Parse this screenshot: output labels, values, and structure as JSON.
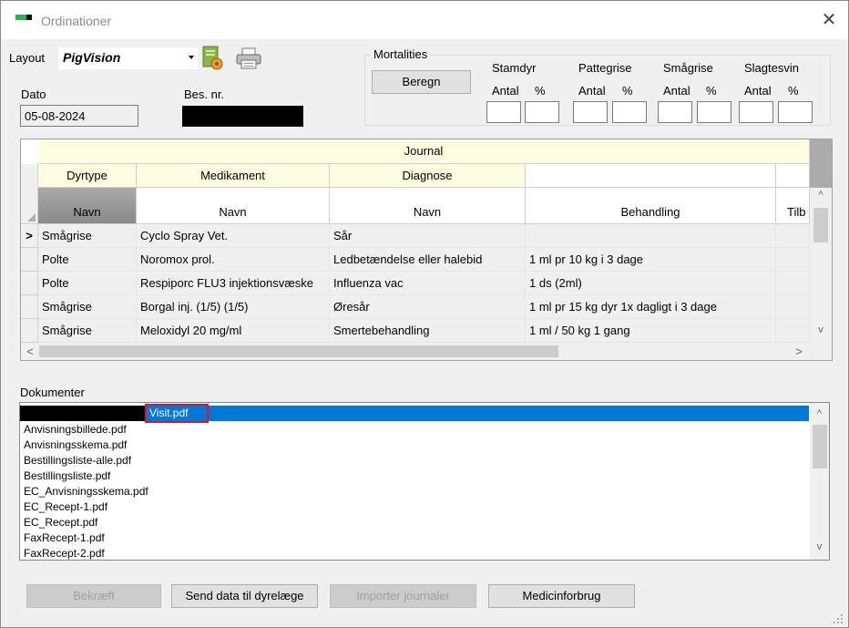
{
  "window": {
    "title": "Ordinationer",
    "close_glyph": "✕"
  },
  "layout": {
    "label": "Layout",
    "value": "PigVision"
  },
  "dato": {
    "label": "Dato",
    "value": "05-08-2024"
  },
  "besnr": {
    "label": "Bes. nr.",
    "value": ""
  },
  "mortalities": {
    "legend": "Mortalities",
    "button": "Beregn",
    "groups": [
      {
        "name": "Stamdyr",
        "antal": "Antal",
        "pct": "%"
      },
      {
        "name": "Pattegrise",
        "antal": "Antal",
        "pct": "%"
      },
      {
        "name": "Smågrise",
        "antal": "Antal",
        "pct": "%"
      },
      {
        "name": "Slagtesvin",
        "antal": "Antal",
        "pct": "%"
      }
    ]
  },
  "grid": {
    "band_title": "Journal",
    "group_headers": [
      "Dyrtype",
      "Medikament",
      "Diagnose"
    ],
    "columns": [
      "Navn",
      "Navn",
      "Navn",
      "Behandling",
      "Tilb"
    ],
    "current_row_marker": ">",
    "rows": [
      [
        "Smågrise",
        "Cyclo Spray Vet.",
        "Sår",
        ""
      ],
      [
        "Polte",
        "Noromox prol.",
        "Ledbetændelse eller halebid",
        "1 ml pr 10 kg i 3 dage"
      ],
      [
        "Polte",
        "Respiporc FLU3 injektionsvæske",
        "Influenza vac",
        "1 ds (2ml)"
      ],
      [
        "Smågrise",
        "Borgal inj. (1/5) (1/5)",
        "Øresår",
        "1 ml pr 15 kg dyr 1x dagligt i 3 dage"
      ],
      [
        "Smågrise",
        "Meloxidyl 20 mg/ml",
        "Smertebehandling",
        "1 ml / 50 kg 1 gang"
      ]
    ],
    "scroll_up": "^",
    "scroll_down": "v",
    "scroll_left": "<",
    "scroll_right": ">"
  },
  "documents": {
    "label": "Dokumenter",
    "selected": "Visit.pdf",
    "items": [
      "Anvisningsbillede.pdf",
      "Anvisningsskema.pdf",
      "Bestillingsliste-alle.pdf",
      "Bestillingsliste.pdf",
      "EC_Anvisningsskema.pdf",
      "EC_Recept-1.pdf",
      "EC_Recept.pdf",
      "FaxRecept-1.pdf",
      "FaxRecept-2.pdf"
    ]
  },
  "buttons": {
    "bekraeft": "Bekræft",
    "send": "Send data til dyrelæge",
    "importer": "Importer journaler",
    "medicinforbrug": "Medicinforbrug"
  },
  "colors": {
    "selection": "#0078d7",
    "highlight_box": "#e81123",
    "journal_header": "#fefee1"
  }
}
